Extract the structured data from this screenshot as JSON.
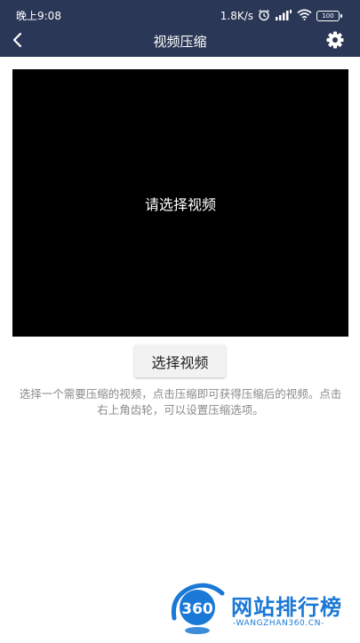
{
  "status_bar": {
    "time": "晚上9:08",
    "network_speed": "1.8K/s",
    "battery_level": "100",
    "icons": [
      "alarm-icon",
      "signal-hd-icon",
      "wifi-icon",
      "battery-icon"
    ]
  },
  "app_bar": {
    "title": "视频压缩",
    "back_icon": "chevron-left-icon",
    "settings_icon": "gear-icon",
    "background_color": "#2b3756"
  },
  "preview": {
    "placeholder": "请选择视频",
    "background_color": "#000000"
  },
  "select_button": {
    "label": "选择视频"
  },
  "hint": {
    "text": "选择一个需要压缩的视频，点击压缩即可获得压缩后的视频。点击右上角齿轮，可以设置压缩选项。"
  },
  "watermark": {
    "logo_text": "360",
    "name": "网站排行榜",
    "url": "-WANGZHAN360.CN-",
    "color": "#1a78d6"
  }
}
